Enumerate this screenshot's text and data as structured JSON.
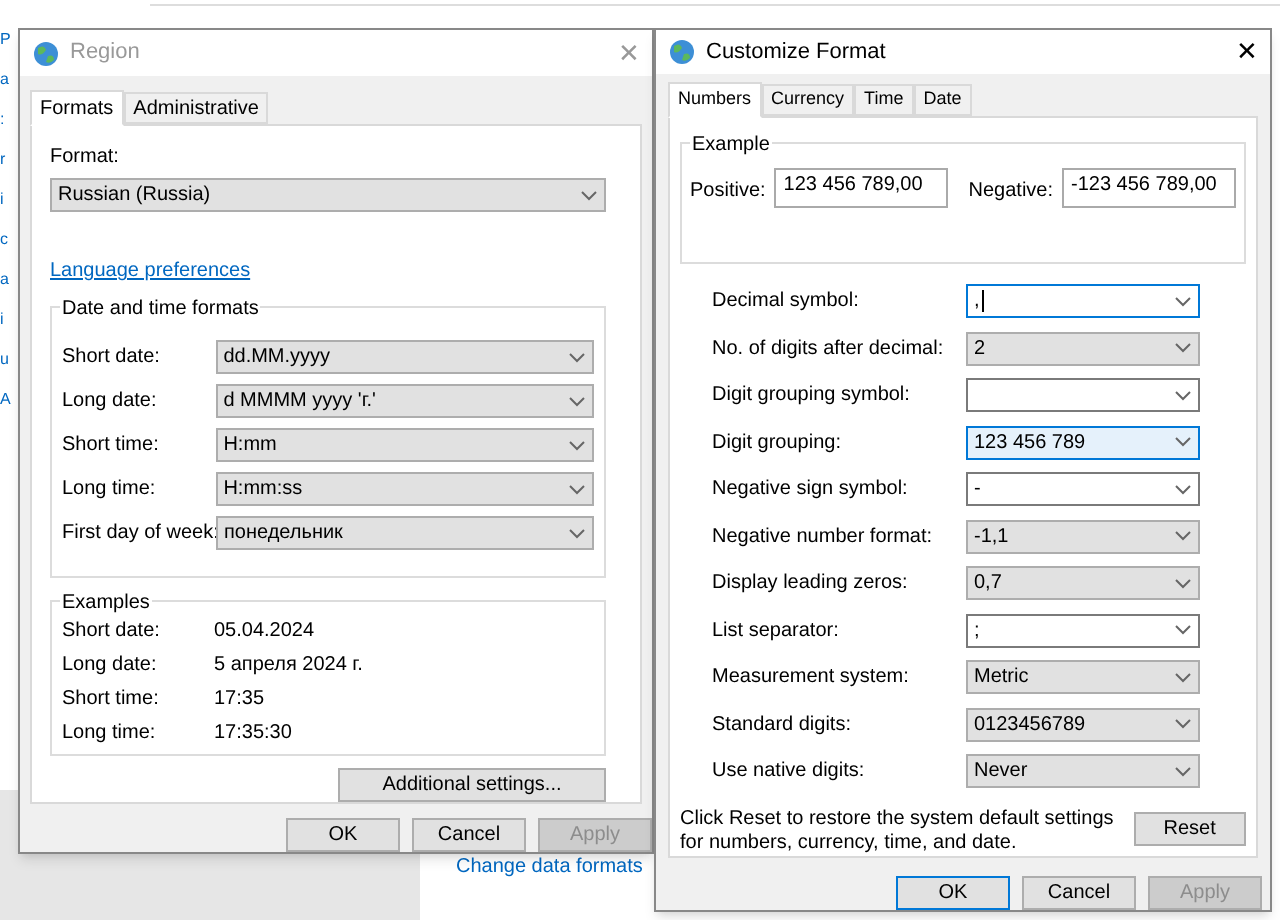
{
  "background": {
    "side_fragments": [
      "P",
      "a",
      ":",
      "r",
      "i",
      "c",
      "a",
      "i",
      "u",
      "A"
    ],
    "link": "Change data formats"
  },
  "region": {
    "title": "Region",
    "close": "✕",
    "tabs": [
      {
        "label": "Formats",
        "selected": true
      },
      {
        "label": "Administrative",
        "selected": false
      }
    ],
    "format_label": "Format:",
    "format_value": "Russian (Russia)",
    "language_link": "Language preferences",
    "formats_group": {
      "title": "Date and time formats",
      "rows": [
        {
          "label": "Short date:",
          "value": "dd.MM.yyyy"
        },
        {
          "label": "Long date:",
          "value": "d MMMM yyyy 'г.'"
        },
        {
          "label": "Short time:",
          "value": "H:mm"
        },
        {
          "label": "Long time:",
          "value": "H:mm:ss"
        },
        {
          "label": "First day of week:",
          "value": "понедельник"
        }
      ]
    },
    "examples_group": {
      "title": "Examples",
      "rows": [
        {
          "label": "Short date:",
          "value": "05.04.2024"
        },
        {
          "label": "Long date:",
          "value": "5 апреля 2024 г."
        },
        {
          "label": "Short time:",
          "value": "17:35"
        },
        {
          "label": "Long time:",
          "value": "17:35:30"
        }
      ]
    },
    "additional_button": "Additional settings...",
    "buttons": [
      {
        "label": "OK",
        "default": false,
        "disabled": false
      },
      {
        "label": "Cancel",
        "default": false,
        "disabled": false
      },
      {
        "label": "Apply",
        "default": false,
        "disabled": true
      }
    ]
  },
  "customize": {
    "title": "Customize Format",
    "close": "✕",
    "tabs": [
      {
        "label": "Numbers",
        "selected": true
      },
      {
        "label": "Currency",
        "selected": false
      },
      {
        "label": "Time",
        "selected": false
      },
      {
        "label": "Date",
        "selected": false
      }
    ],
    "example": {
      "title": "Example",
      "positive_label": "Positive:",
      "positive": "123 456 789,00",
      "negative_label": "Negative:",
      "negative": "-123 456 789,00"
    },
    "rows": [
      {
        "label": "Decimal symbol:",
        "value": ",",
        "kind": "editable",
        "focused": true
      },
      {
        "label": "No. of digits after decimal:",
        "value": "2",
        "kind": "list",
        "focused": false
      },
      {
        "label": "Digit grouping symbol:",
        "value": "",
        "kind": "editable",
        "focused": false
      },
      {
        "label": "Digit grouping:",
        "value": "123 456 789",
        "kind": "hover",
        "focused": false
      },
      {
        "label": "Negative sign symbol:",
        "value": "-",
        "kind": "editable",
        "focused": false
      },
      {
        "label": "Negative number format:",
        "value": "-1,1",
        "kind": "list",
        "focused": false
      },
      {
        "label": "Display leading zeros:",
        "value": "0,7",
        "kind": "list",
        "focused": false
      },
      {
        "label": "List separator:",
        "value": ";",
        "kind": "editable",
        "focused": false
      },
      {
        "label": "Measurement system:",
        "value": "Metric",
        "kind": "list",
        "focused": false
      },
      {
        "label": "Standard digits:",
        "value": "0123456789",
        "kind": "list",
        "focused": false
      },
      {
        "label": "Use native digits:",
        "value": "Never",
        "kind": "list",
        "focused": false
      }
    ],
    "reset_note": "Click Reset to restore the system default settings for numbers, currency, time, and date.",
    "reset_button": "Reset",
    "buttons": [
      {
        "label": "OK",
        "default": true,
        "disabled": false
      },
      {
        "label": "Cancel",
        "default": false,
        "disabled": false
      },
      {
        "label": "Apply",
        "default": false,
        "disabled": true
      }
    ]
  }
}
